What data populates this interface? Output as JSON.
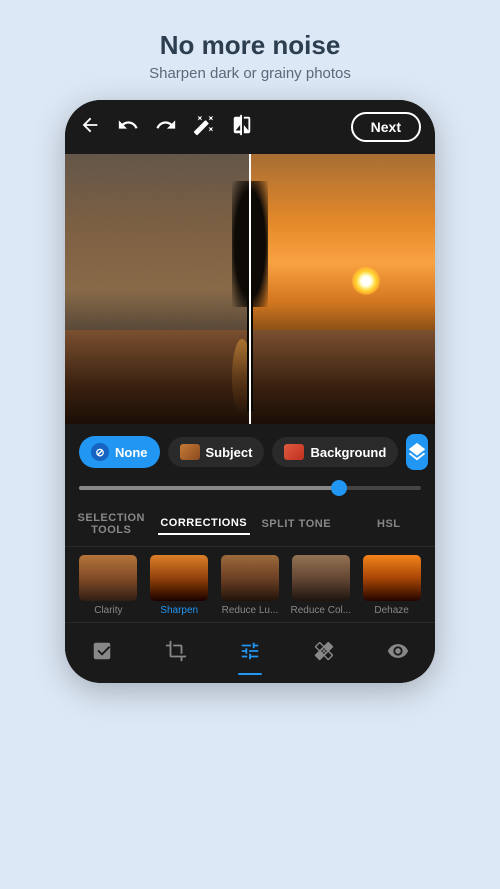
{
  "header": {
    "title": "No more noise",
    "subtitle": "Sharpen dark or grainy photos"
  },
  "toolbar": {
    "next_label": "Next"
  },
  "selection": {
    "none_label": "None",
    "subject_label": "Subject",
    "background_label": "Background"
  },
  "tabs": [
    {
      "id": "selection-tools",
      "label": "SELECTION TOOLS",
      "active": false
    },
    {
      "id": "corrections",
      "label": "CORRECTIONS",
      "active": true
    },
    {
      "id": "split-tone",
      "label": "SPLIT TONE",
      "active": false
    },
    {
      "id": "hsl",
      "label": "HSL",
      "active": false
    }
  ],
  "corrections": [
    {
      "id": "clarity",
      "label": "Clarity",
      "active": false
    },
    {
      "id": "sharpen",
      "label": "Sharpen",
      "active": true
    },
    {
      "id": "reduce-luminance",
      "label": "Reduce Lu...",
      "active": false
    },
    {
      "id": "reduce-color",
      "label": "Reduce Col...",
      "active": false
    },
    {
      "id": "dehaze",
      "label": "Dehaze",
      "active": false
    }
  ],
  "bottom_nav": [
    {
      "id": "auto",
      "icon": "auto",
      "active": false
    },
    {
      "id": "crop",
      "icon": "crop",
      "active": false
    },
    {
      "id": "adjust",
      "icon": "adjust",
      "active": true
    },
    {
      "id": "heal",
      "icon": "heal",
      "active": false
    },
    {
      "id": "eye",
      "icon": "eye",
      "active": false
    }
  ],
  "colors": {
    "accent": "#2196f3",
    "background_app": "#dce8f5",
    "phone_bg": "#1a1a1a",
    "text_primary": "#ffffff",
    "text_secondary": "#888888"
  }
}
